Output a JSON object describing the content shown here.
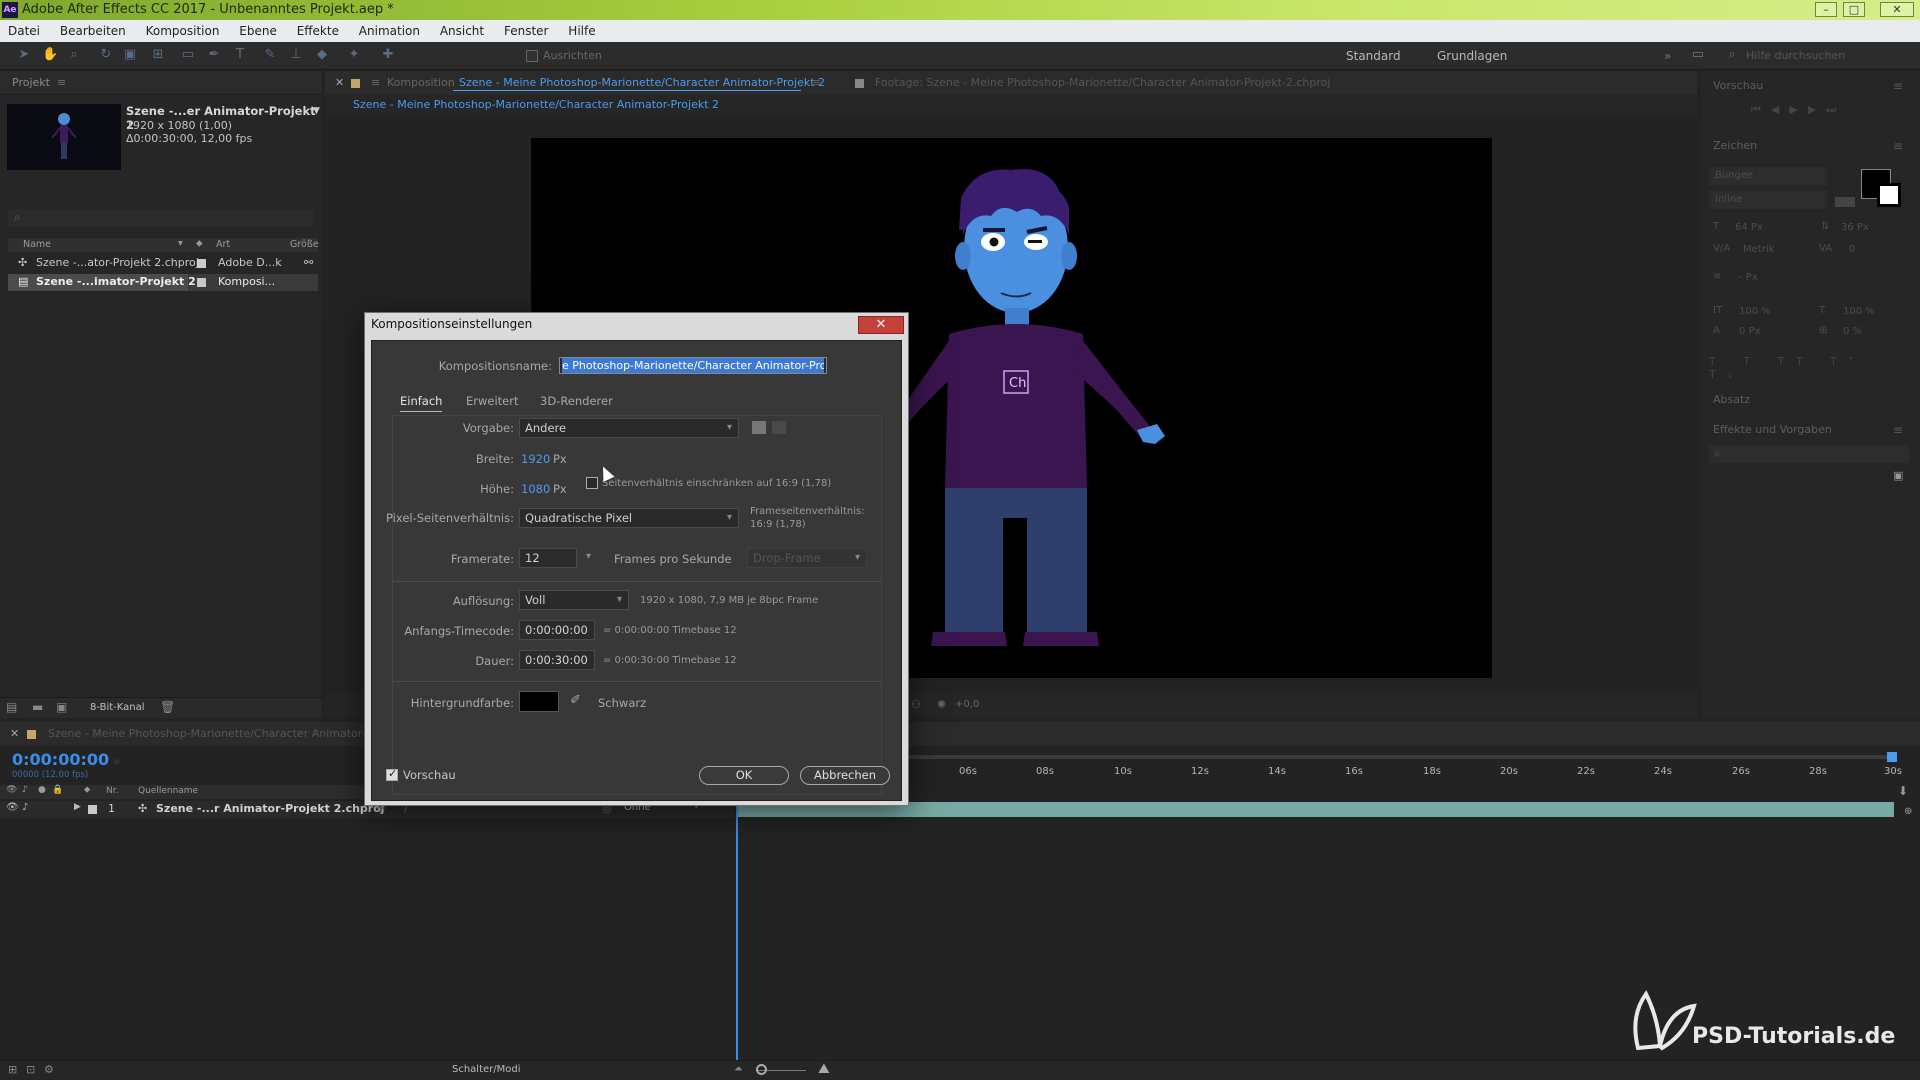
{
  "window": {
    "title": "Adobe After Effects CC 2017 - Unbenanntes Projekt.aep *",
    "app_badge": "Ae"
  },
  "menu": [
    "Datei",
    "Bearbeiten",
    "Komposition",
    "Ebene",
    "Effekte",
    "Animation",
    "Ansicht",
    "Fenster",
    "Hilfe"
  ],
  "toolbar": {
    "align_label": "Ausrichten",
    "workspace1": "Standard",
    "workspace2": "Grundlagen",
    "help_search": "Hilfe durchsuchen"
  },
  "project": {
    "panel_title": "Projekt",
    "comp_name": "Szene -...er Animator-Projekt 2",
    "comp_res": "1920 x 1080 (1,00)",
    "comp_dur": "Δ0:00:30:00, 12,00 fps",
    "search_placeholder": "",
    "columns": {
      "name": "Name",
      "type": "Art",
      "size": "Größe"
    },
    "items": [
      {
        "name": "Szene -...ator-Projekt 2.chproj",
        "type": "Adobe D...k"
      },
      {
        "name": "Szene -...imator-Projekt 2",
        "type": "Komposi..."
      }
    ],
    "bit_depth": "8-Bit-Kanal"
  },
  "viewer": {
    "tab_label": "Komposition",
    "tab_comp": "Szene - Meine Photoshop-Marionette/Character Animator-Projekt 2",
    "footage_tab": "Footage: Szene - Meine Photoshop-Marionette/Character Animator-Projekt-2.chproj",
    "breadcrumb": "Szene - Meine Photoshop-Marionette/Character Animator-Projekt 2",
    "shirt_logo": "Ch",
    "exposure": "+0,0"
  },
  "right_panel": {
    "preview": "Vorschau",
    "character": "Zeichen",
    "font": "Bungee",
    "style": "Inline",
    "font_size": "64 Px",
    "leading": "36 Px",
    "kerning": "Metrik",
    "tracking": "0",
    "stroke": "- Px",
    "vscale": "100 %",
    "hscale": "100 %",
    "baseline": "0 Px",
    "tsume": "0 %",
    "paragraph": "Absatz",
    "effects": "Effekte und Vorgaben"
  },
  "timeline": {
    "tab": "Szene - Meine Photoshop-Marionette/Character Animator-Proj...",
    "timecode": "0:00:00:00",
    "fps_sub": "00000 (12,00 fps)",
    "col_nr": "Nr.",
    "col_source": "Quellenname",
    "layer_num": "1",
    "layer_name": "Szene -...r Animator-Projekt 2.chproj",
    "parent": "Ohne",
    "switch_modes": "Schalter/Modi",
    "ticks": [
      "06s",
      "08s",
      "10s",
      "12s",
      "14s",
      "16s",
      "18s",
      "20s",
      "22s",
      "24s",
      "26s",
      "28s",
      "30s"
    ]
  },
  "dialog": {
    "title": "Kompositionseinstellungen",
    "name_label": "Kompositionsname:",
    "name_value": "e Photoshop-Marionette/Character Animator-Projekt 2",
    "tabs": [
      "Einfach",
      "Erweitert",
      "3D-Renderer"
    ],
    "preset_label": "Vorgabe:",
    "preset_value": "Andere",
    "width_label": "Breite:",
    "width_value": "1920",
    "height_label": "Höhe:",
    "height_value": "1080",
    "px": "Px",
    "lock_aspect": "Seitenverhältnis einschränken auf 16:9 (1,78)",
    "par_label": "Pixel-Seitenverhältnis:",
    "par_value": "Quadratische Pixel",
    "frame_aspect_label": "Frameseitenverhältnis:",
    "frame_aspect_value": "16:9 (1,78)",
    "fps_label": "Framerate:",
    "fps_value": "12",
    "fps_unit": "Frames pro Sekunde",
    "drop_frame": "Drop-Frame",
    "res_label": "Auflösung:",
    "res_value": "Voll",
    "res_info": "1920 x 1080, 7,9 MB je 8bpc Frame",
    "start_label": "Anfangs-Timecode:",
    "start_value": "0:00:00:00",
    "start_info": "= 0:00:00:00  Timebase 12",
    "dur_label": "Dauer:",
    "dur_value": "0:00:30:00",
    "dur_info": "= 0:00:30:00  Timebase 12",
    "bg_label": "Hintergrundfarbe:",
    "bg_name": "Schwarz",
    "preview_label": "Vorschau",
    "ok": "OK",
    "cancel": "Abbrechen"
  },
  "watermark": "PSD-Tutorials.de"
}
